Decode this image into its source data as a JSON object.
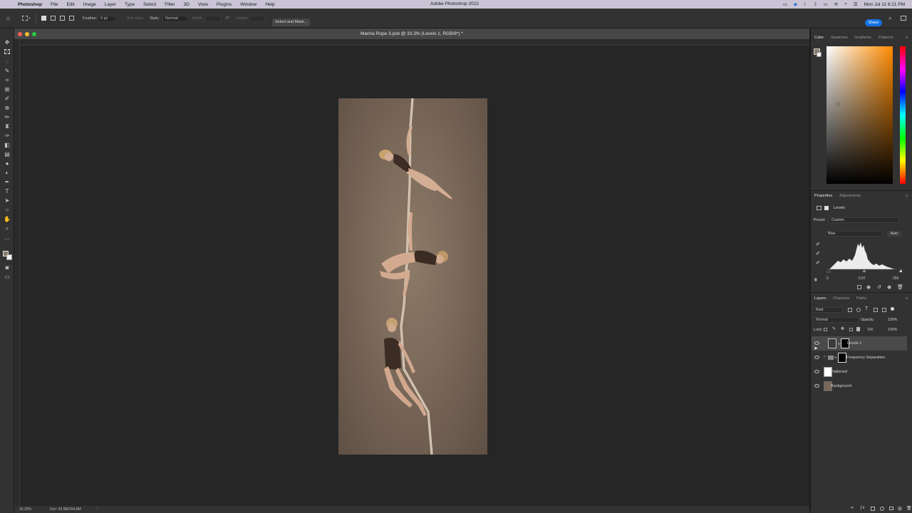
{
  "menubar": {
    "app_name": "Photoshop",
    "items": [
      "File",
      "Edit",
      "Image",
      "Layer",
      "Type",
      "Select",
      "Filter",
      "3D",
      "View",
      "Plugins",
      "Window",
      "Help"
    ],
    "window_title": "Adobe Photoshop 2022",
    "clock": "Mon Jul 11  8:21 PM"
  },
  "options": {
    "feather_label": "Feather:",
    "feather_value": "0 px",
    "antialias_label": "Anti-alias",
    "style_label": "Style:",
    "style_value": "Normal",
    "width_label": "Width:",
    "height_label": "Height:",
    "select_mask_label": "Select and Mask...",
    "share_label": "Share"
  },
  "document": {
    "title": "Marina Rope 3.psb @ 33.3% (Levels 1, RGB/8*) *",
    "zoom": "33.33%",
    "doc_size": "Doc: 42.9M/164.8M"
  },
  "color_panel": {
    "tabs": [
      "Color",
      "Swatches",
      "Gradients",
      "Patterns"
    ],
    "active_tab": "Color",
    "base_hue": "#ff8b00"
  },
  "properties_panel": {
    "tabs": [
      "Properties",
      "Adjustments"
    ],
    "adjustment_name": "Levels",
    "preset_label": "Preset:",
    "preset_value": "Custom",
    "channel_value": "Blue",
    "auto_label": "Auto",
    "input_black": "0",
    "input_gamma": "0.97",
    "input_white": "255"
  },
  "layers_panel": {
    "tabs": [
      "Layers",
      "Channels",
      "Paths"
    ],
    "filter_kind": "Kind",
    "blend_mode": "Normal",
    "opacity_label": "Opacity:",
    "opacity_value": "100%",
    "lock_label": "Lock:",
    "fill_label": "Fill:",
    "fill_value": "100%",
    "layers": [
      {
        "name": "Levels 1",
        "selected": true
      },
      {
        "name": "Frequency Separation",
        "selected": false
      },
      {
        "name": "Flattened",
        "selected": false
      },
      {
        "name": "Background",
        "selected": false
      }
    ]
  }
}
